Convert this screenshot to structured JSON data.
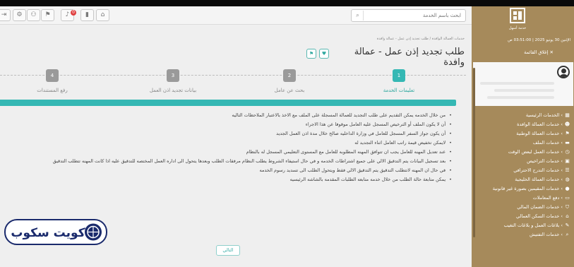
{
  "topbar": {
    "search_placeholder": "ابحث باسم الخدمة",
    "notification_count": "0"
  },
  "sidebar": {
    "logo_text": "خدمة أسهل",
    "date_line": "الإثنين 30 يونيو 2025 | 03:51:00 ص",
    "logout_label": "إغلاق القائمة",
    "items": [
      {
        "label": "الخدمات الرئيسية",
        "icon": "grid-icon"
      },
      {
        "label": "خدمات العمالة الوافدة",
        "icon": "user-icon"
      },
      {
        "label": "خدمات العمالة الوطنية",
        "icon": "flag-icon"
      },
      {
        "label": "خدمات الملف",
        "icon": "folder-icon"
      },
      {
        "label": "خدمات العمل لبعض الوقت",
        "icon": "clock-icon"
      },
      {
        "label": "خدمات التراخيص",
        "icon": "license-icon"
      },
      {
        "label": "خدمات التدرج الاحترافي",
        "icon": "ladder-icon"
      },
      {
        "label": "خدمات العمالة الخليجية",
        "icon": "globe-icon"
      },
      {
        "label": "خدمات المقيمين بصورة غير قانونية",
        "icon": "warning-icon"
      },
      {
        "label": "دفع المعاملات",
        "icon": "payment-icon"
      },
      {
        "label": "خدمات الضمان المالي",
        "icon": "shield-icon"
      },
      {
        "label": "خدمات السكن العمالي",
        "icon": "home-icon"
      },
      {
        "label": "بلاغات العمل و بلاغات التغيب",
        "icon": "report-icon"
      },
      {
        "label": "خدمات التفتيش",
        "icon": "search-icon"
      }
    ]
  },
  "main": {
    "breadcrumb": "خدمات العمالة الوافدة / طلب تجديد إذن عمل - عمالة وافدة",
    "title": "طلب تجديد إذن عمل - عمالة وافدة",
    "steps": [
      {
        "number": "1",
        "label": "تعليمات الخدمة",
        "active": true
      },
      {
        "number": "2",
        "label": "بحث عن عامل",
        "active": false
      },
      {
        "number": "3",
        "label": "بيانات تجديد اذن العمل",
        "active": false
      },
      {
        "number": "4",
        "label": "رفع المستندات",
        "active": false
      }
    ],
    "notes": [
      "من خلال الخدمه يمكن التقديم على طلب التجديد للعمالة المسجلة على الملف مع الاخذ بالاعتبار الملاحظات التاليه",
      "أن لا يكون الملف أو الترخيص المسجل عليه العامل موقوفا عن هذا الاجراء",
      "أن يكون جواز السفر المسجل للعامل في وزارة الداخليه صالح خلال مدة اذن العمل الجديد",
      "لايمكن تخفيض قيمة راتب العامل اثناء التجديد له",
      "عند تعديل المهنه للعامل يجب ان تتوافق المهنه المطلوبه للعامل مع المستوى التعليمي المسجل له بالنظام",
      "بعد تسجيل البيانات يتم التدقيق الالي على جميع اشتراطات الخدمه و في حال استيفاء الشروط يطلب النظام مرفقات الطلب وبعدها يتحول الى اداره العمل المختصه للتدقيق عليه اذا كانت المهنه تتطلب التدقيق",
      "في حال ان المهنه لاتتطلب التدقيق يتم التدقيق الالي فقط ويتحول الطلب الى تسديد رسوم الخدمه",
      "يمكن متابعة حالة الطلب من خلال خدمه متابعه الطلبات المقدمه بالشاشه الرئيسيه"
    ],
    "next_label": "التالي"
  },
  "watermark": {
    "text": "كويت سكوب"
  },
  "colors": {
    "sidebar": "#a68a5b",
    "accent_teal": "#35b8b4",
    "inactive_step": "#9a9a9a"
  }
}
